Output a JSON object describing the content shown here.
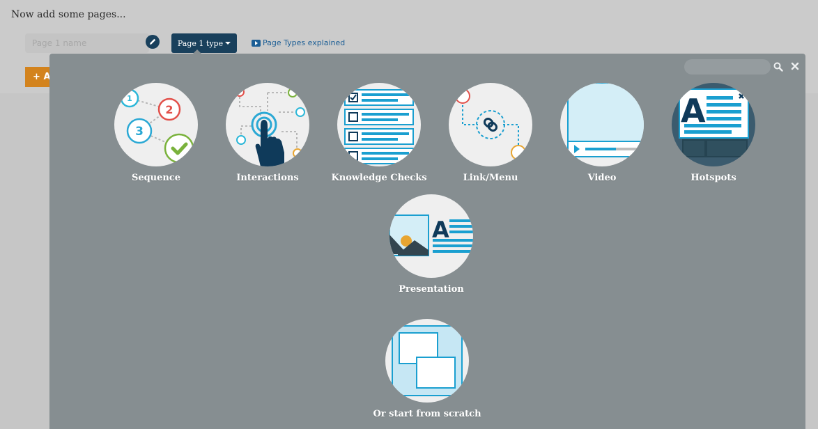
{
  "header": {
    "title": "Now add some pages...",
    "page_name_placeholder": "Page 1 name",
    "page_type_label": "Page 1 type",
    "explained_link": "Page Types explained",
    "add_button_label": "A"
  },
  "panel": {
    "search_placeholder": "",
    "tiles": [
      {
        "id": "sequence",
        "label": "Sequence",
        "icon": "sequence-icon"
      },
      {
        "id": "interactions",
        "label": "Interactions",
        "icon": "interactions-icon"
      },
      {
        "id": "knowledge-checks",
        "label": "Knowledge Checks",
        "icon": "knowledge-checks-icon"
      },
      {
        "id": "link-menu",
        "label": "Link/Menu",
        "icon": "link-menu-icon"
      },
      {
        "id": "video",
        "label": "Video",
        "icon": "video-icon"
      },
      {
        "id": "hotspots",
        "label": "Hotspots",
        "icon": "hotspots-icon"
      },
      {
        "id": "presentation",
        "label": "Presentation",
        "icon": "presentation-icon"
      },
      {
        "id": "scratch",
        "label": "Or start from scratch",
        "icon": "scratch-icon"
      }
    ]
  },
  "colors": {
    "navy": "#19405c",
    "accent_blue": "#1a9fd0",
    "orange": "#d3831d",
    "panel": "#868e91"
  }
}
